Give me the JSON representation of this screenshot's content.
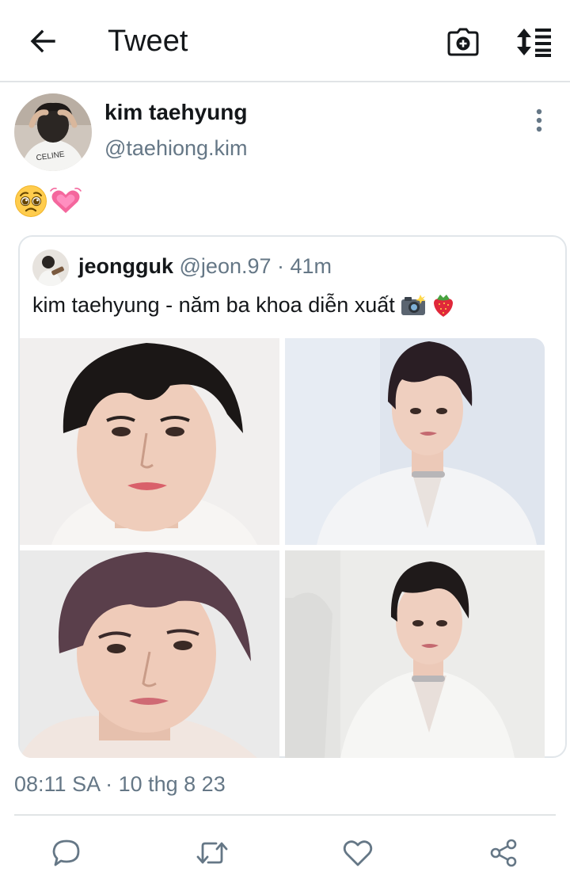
{
  "header": {
    "title": "Tweet",
    "back_icon": "arrow-left-icon",
    "camera_icon": "camera-plus-icon",
    "sort_icon": "sort-list-icon"
  },
  "tweet": {
    "author": {
      "name": "kim taehyung",
      "handle": "@taehiong.kim",
      "shirt_text": "CELINE"
    },
    "body_emojis": [
      "pleading-face-emoji",
      "growing-heart-emoji"
    ],
    "timestamp": "08:11 SA · 10 thg 8 23"
  },
  "quote": {
    "name": "jeongguk",
    "meta": "@jeon.97 · 41m",
    "text": "kim taehyung - năm ba khoa diễn xuất",
    "text_emojis": [
      "camera-flash-emoji",
      "strawberry-emoji"
    ],
    "photos": [
      "portrait-photo-1",
      "portrait-photo-2",
      "portrait-photo-3",
      "portrait-photo-4"
    ]
  },
  "actions": [
    "reply-icon",
    "retweet-icon",
    "like-icon",
    "share-icon"
  ],
  "colors": {
    "text": "#14171a",
    "secondary": "#657786",
    "icon": "#657786",
    "border": "#e1e6ea"
  }
}
